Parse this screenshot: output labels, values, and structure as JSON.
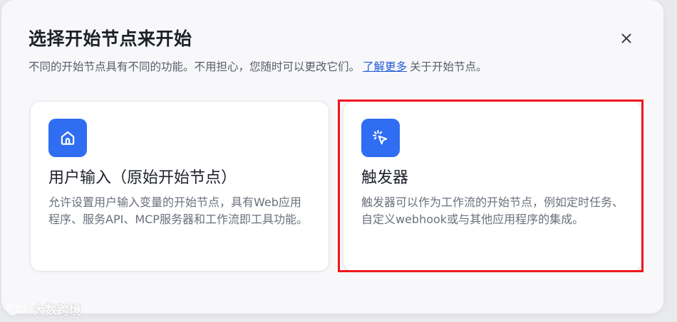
{
  "dialog": {
    "title": "选择开始节点来开始",
    "subtitle_prefix": "不同的开始节点具有不同的功能。不用担心，您随时可以更改它们。",
    "learn_more_link": "了解更多",
    "subtitle_suffix": "关于开始节点。",
    "close_icon": "close-icon"
  },
  "options": [
    {
      "icon": "home-icon",
      "title": "用户输入（原始开始节点）",
      "description": "允许设置用户输入变量的开始节点，具有Web应用程序、服务API、MCP服务器和工作流即工具功能。"
    },
    {
      "icon": "click-cursor-icon",
      "title": "触发器",
      "description": "触发器可以作为工作流的开始节点，例如定时任务、自定义webhook或与其他应用程序的集成。"
    }
  ],
  "highlight_color": "#f0161d",
  "accent_color": "#2f6df2",
  "watermark": {
    "icon": "watermark-logo-icon",
    "text": "大数跨境"
  }
}
